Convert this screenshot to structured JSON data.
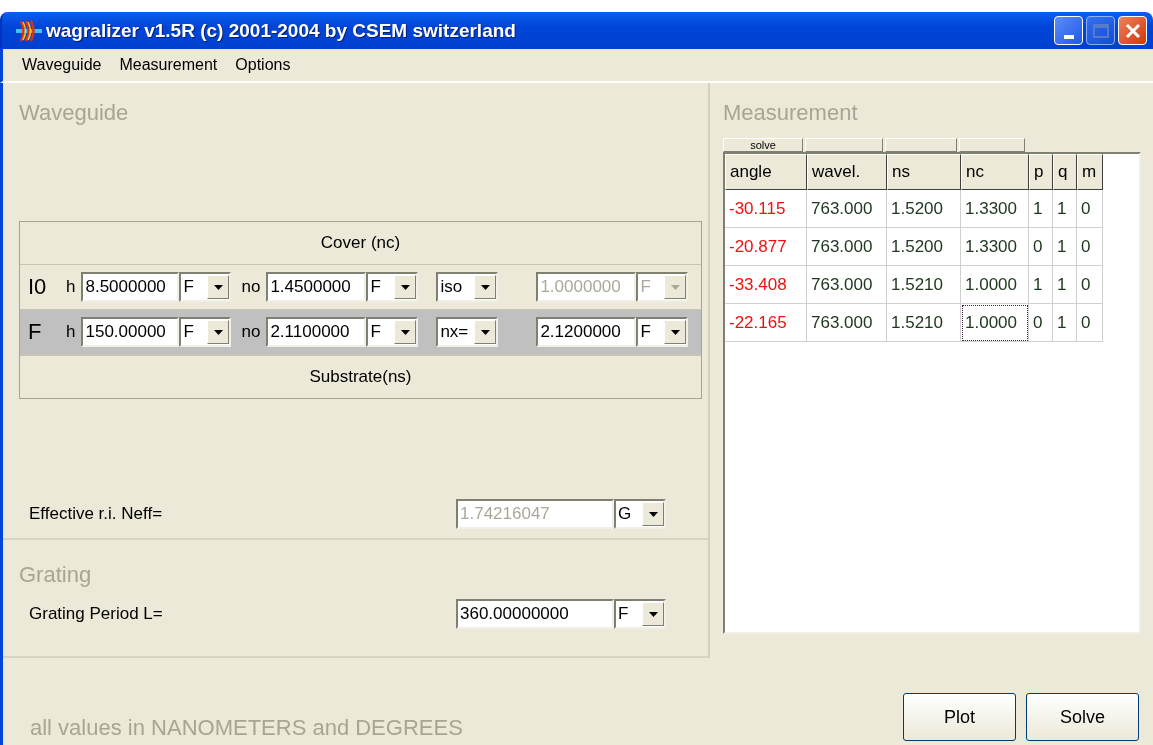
{
  "window": {
    "title": "wagralizer v1.5R (c) 2001-2004 by CSEM switzerland"
  },
  "menu": [
    {
      "label": "Waveguide"
    },
    {
      "label": "Measurement"
    },
    {
      "label": "Options"
    }
  ],
  "waveguide": {
    "title": "Waveguide",
    "cover": "Cover (nc)",
    "substrate": "Substrate(ns)",
    "layers": [
      {
        "label": "I0",
        "selected": false,
        "h_label": "h",
        "h": "8.5000000",
        "h_mode": "F",
        "no_label": "no",
        "no": "1.4500000",
        "no_mode": "F",
        "type": "iso",
        "extra": "1.0000000",
        "extra_mode": "F",
        "extra_disabled": true
      },
      {
        "label": "F",
        "selected": true,
        "h_label": "h",
        "h": "150.00000",
        "h_mode": "F",
        "no_label": "no",
        "no": "2.1100000",
        "no_mode": "F",
        "type": "nx=",
        "extra": "2.1200000",
        "extra_mode": "F",
        "extra_disabled": false
      }
    ],
    "neff": {
      "label": "Effective r.i. Neff=",
      "value": "1.74216047",
      "mode": "G",
      "disabled": true
    }
  },
  "grating": {
    "title": "Grating",
    "period": {
      "label": "Grating Period L=",
      "value": "360.00000000",
      "mode": "F",
      "disabled": false
    }
  },
  "measurement": {
    "title": "Measurement",
    "columns": [
      {
        "label": "angle",
        "kind": "result",
        "has_button": true,
        "button_label": "solve"
      },
      {
        "label": "wavel.",
        "kind": "input",
        "has_button": true
      },
      {
        "label": "ns",
        "kind": "input",
        "has_button": true
      },
      {
        "label": "nc",
        "kind": "input",
        "has_button": true
      },
      {
        "label": "p",
        "kind": "input",
        "has_button": false
      },
      {
        "label": "q",
        "kind": "input",
        "has_button": false
      },
      {
        "label": "m",
        "kind": "input",
        "has_button": false
      }
    ],
    "rows": [
      {
        "cells": [
          {
            "text": "-30.115",
            "focused": false
          },
          {
            "text": "763.000",
            "focused": false
          },
          {
            "text": "1.5200",
            "focused": false
          },
          {
            "text": "1.3300",
            "focused": false
          },
          {
            "text": "1",
            "focused": false
          },
          {
            "text": "1",
            "focused": false
          },
          {
            "text": "0",
            "focused": false
          }
        ]
      },
      {
        "cells": [
          {
            "text": "-20.877",
            "focused": false
          },
          {
            "text": "763.000",
            "focused": false
          },
          {
            "text": "1.5200",
            "focused": false
          },
          {
            "text": "1.3300",
            "focused": false
          },
          {
            "text": "0",
            "focused": false
          },
          {
            "text": "1",
            "focused": false
          },
          {
            "text": "0",
            "focused": false
          }
        ]
      },
      {
        "cells": [
          {
            "text": "-33.408",
            "focused": false
          },
          {
            "text": "763.000",
            "focused": false
          },
          {
            "text": "1.5210",
            "focused": false
          },
          {
            "text": "1.0000",
            "focused": false
          },
          {
            "text": "1",
            "focused": false
          },
          {
            "text": "1",
            "focused": false
          },
          {
            "text": "0",
            "focused": false
          }
        ]
      },
      {
        "cells": [
          {
            "text": "-22.165",
            "focused": false
          },
          {
            "text": "763.000",
            "focused": false
          },
          {
            "text": "1.5210",
            "focused": false
          },
          {
            "text": "1.0000",
            "focused": true
          },
          {
            "text": "0",
            "focused": false
          },
          {
            "text": "1",
            "focused": false
          },
          {
            "text": "0",
            "focused": false
          }
        ]
      }
    ]
  },
  "footer": {
    "note": "all values in NANOMETERS and DEGREES",
    "buttons": [
      "Plot",
      "Solve"
    ]
  }
}
